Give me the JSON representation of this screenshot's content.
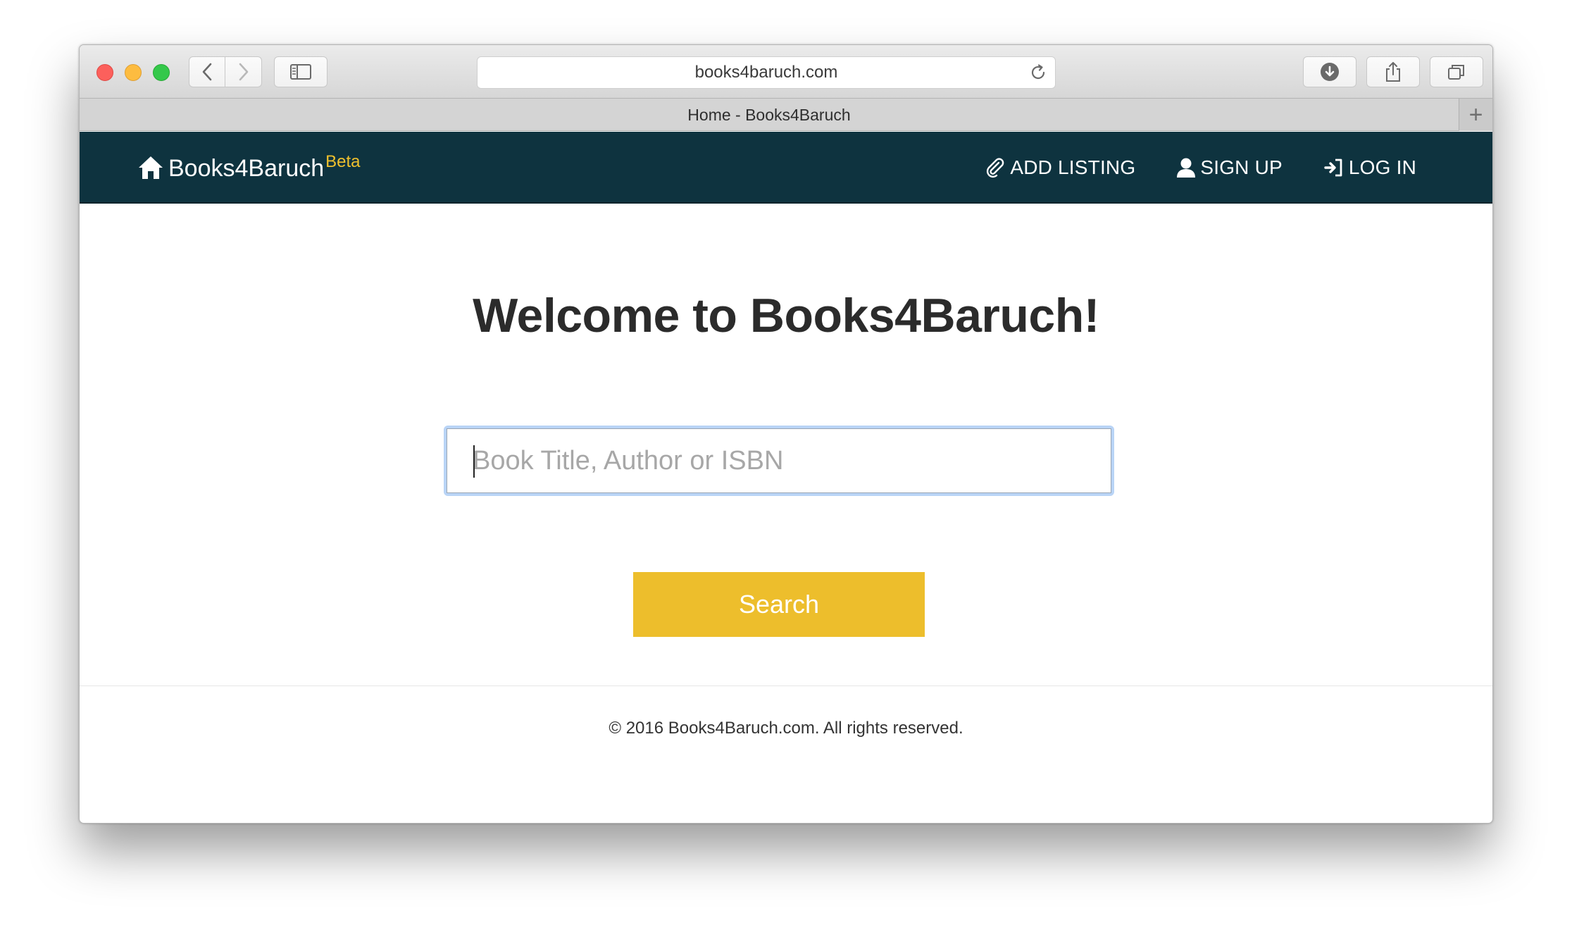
{
  "browser": {
    "url": "books4baruch.com",
    "tab_title": "Home - Books4Baruch",
    "new_tab_label": "+"
  },
  "site": {
    "brand_name": "Books4Baruch",
    "brand_badge": "Beta",
    "nav": [
      {
        "label": "ADD LISTING",
        "icon": "paperclip-icon"
      },
      {
        "label": "SIGN UP",
        "icon": "user-icon"
      },
      {
        "label": "LOG IN",
        "icon": "log-in-icon"
      }
    ],
    "colors": {
      "navbar": "#0e333f",
      "accent": "#edbe2c",
      "badge": "#f0c12d"
    }
  },
  "main": {
    "heading": "Welcome to Books4Baruch!",
    "search_placeholder": "Book Title, Author or ISBN",
    "search_value": "",
    "search_button": "Search"
  },
  "footer": {
    "text": "© 2016 Books4Baruch.com. All rights reserved."
  }
}
